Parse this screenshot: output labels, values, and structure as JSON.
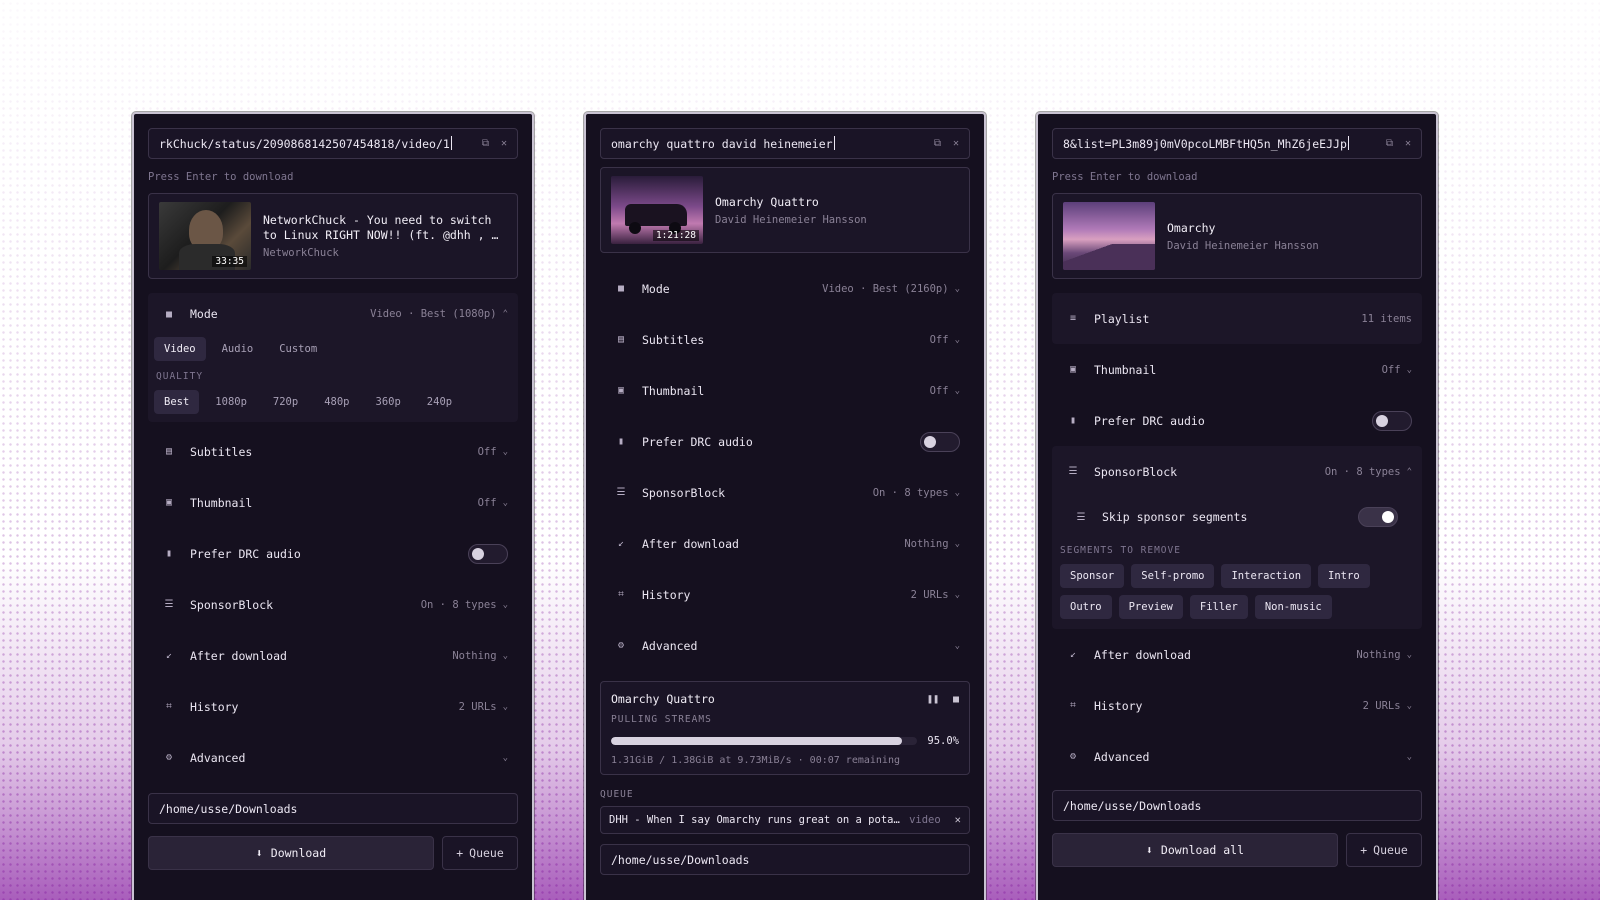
{
  "panels": {
    "left": {
      "url": "rkChuck/status/2090868142507454818/video/1",
      "hint": "Press Enter to download",
      "media": {
        "title": "NetworkChuck - You need to switch to Linux RIGHT NOW!! (ft. @dhh , …",
        "channel": "NetworkChuck",
        "duration": "33:35"
      },
      "mode": {
        "label": "Mode",
        "value": "Video · Best (1080p)"
      },
      "mode_tabs": [
        "Video",
        "Audio",
        "Custom"
      ],
      "quality_label": "QUALITY",
      "qualities": [
        "Best",
        "1080p",
        "720p",
        "480p",
        "360p",
        "240p"
      ],
      "rows": [
        {
          "label": "Subtitles",
          "value": "Off"
        },
        {
          "label": "Thumbnail",
          "value": "Off"
        },
        {
          "label": "Prefer DRC audio",
          "value": ""
        },
        {
          "label": "SponsorBlock",
          "value": "On · 8 types"
        },
        {
          "label": "After download",
          "value": "Nothing"
        },
        {
          "label": "History",
          "value": "2 URLs"
        },
        {
          "label": "Advanced",
          "value": ""
        }
      ],
      "drc_enabled": false,
      "path": "/home/usse/Downloads",
      "primary_button": "Download",
      "secondary_button": "Queue"
    },
    "middle": {
      "url": "omarchy quattro david heinemeier",
      "media": {
        "title": "Omarchy Quattro",
        "channel": "David Heinemeier Hansson",
        "duration": "1:21:28"
      },
      "rows": [
        {
          "label": "Mode",
          "value": "Video · Best (2160p)"
        },
        {
          "label": "Subtitles",
          "value": "Off"
        },
        {
          "label": "Thumbnail",
          "value": "Off"
        },
        {
          "label": "Prefer DRC audio",
          "value": ""
        },
        {
          "label": "SponsorBlock",
          "value": "On · 8 types"
        },
        {
          "label": "After download",
          "value": "Nothing"
        },
        {
          "label": "History",
          "value": "2 URLs"
        },
        {
          "label": "Advanced",
          "value": ""
        }
      ],
      "drc_enabled": false,
      "progress": {
        "title": "Omarchy Quattro",
        "status": "PULLING STREAMS",
        "percent": 95.0,
        "percent_label": "95.0%",
        "stats": "1.31GiB / 1.38GiB at 9.73MiB/s · 00:07 remaining"
      },
      "queue_label": "QUEUE",
      "queue": [
        {
          "title": "DHH - When I say Omarchy runs great on a pota…",
          "kind": "video"
        }
      ],
      "path": "/home/usse/Downloads"
    },
    "right": {
      "url": "8&list=PL3m89j0mV0pcoLMBFtHQ5n_MhZ6jeEJJp",
      "hint": "Press Enter to download",
      "media": {
        "title": "Omarchy",
        "channel": "David Heinemeier Hansson"
      },
      "playlist": {
        "label": "Playlist",
        "value": "11 items"
      },
      "rows": [
        {
          "label": "Thumbnail",
          "value": "Off"
        },
        {
          "label": "Prefer DRC audio",
          "value": ""
        },
        {
          "label": "SponsorBlock",
          "value": "On · 8 types"
        }
      ],
      "drc_enabled": false,
      "sponsorblock": {
        "skip_label": "Skip sponsor segments",
        "skip_enabled": true,
        "segments_label": "SEGMENTS TO REMOVE",
        "segments": [
          "Sponsor",
          "Self-promo",
          "Interaction",
          "Intro",
          "Outro",
          "Preview",
          "Filler",
          "Non-music"
        ]
      },
      "rows_after": [
        {
          "label": "After download",
          "value": "Nothing"
        },
        {
          "label": "History",
          "value": "2 URLs"
        },
        {
          "label": "Advanced",
          "value": ""
        }
      ],
      "path": "/home/usse/Downloads",
      "primary_button": "Download all",
      "secondary_button": "Queue"
    }
  },
  "icons": {
    "copy": "copy-icon",
    "close": "close-icon",
    "mode": "video-camera-icon",
    "subtitles": "subtitles-icon",
    "thumbnail": "image-icon",
    "drc": "bar-chart-icon",
    "sponsorblock": "list-icon",
    "after": "arrow-down-left-icon",
    "history": "history-icon",
    "advanced": "gear-icon",
    "download": "download-icon",
    "plus": "plus-icon",
    "pause": "pause-icon",
    "stop": "stop-icon",
    "playlist": "playlist-icon"
  },
  "colors": {
    "panel_bg": "#15101f",
    "accent": "#d8d2e0",
    "background_glow": "#8c28a5"
  }
}
